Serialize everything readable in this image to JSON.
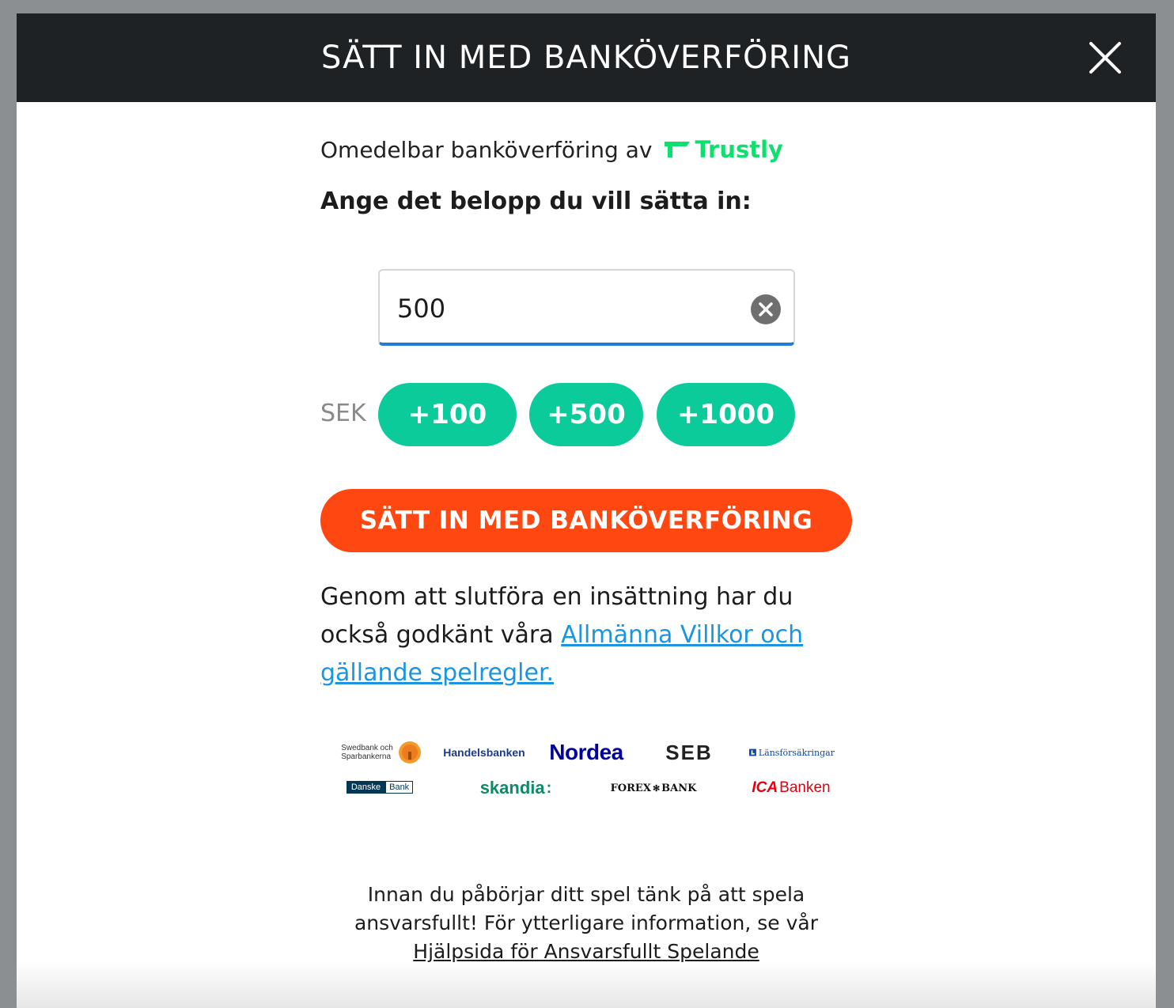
{
  "modal": {
    "title": "SÄTT IN MED BANKÖVERFÖRING"
  },
  "provider": {
    "text": "Omedelbar banköverföring av",
    "brand": "Trustly",
    "brand_color": "#0ee06e"
  },
  "amount": {
    "heading": "Ange det belopp du vill sätta in:",
    "value": "500",
    "currency": "SEK",
    "quick_buttons": [
      "+100",
      "+500",
      "+1000"
    ]
  },
  "deposit_button": "SÄTT IN MED BANKÖVERFÖRING",
  "terms": {
    "text": "Genom att slutföra en insättning har du också godkänt våra ",
    "link": "Allmänna Villkor och gällande spelregler."
  },
  "banks": [
    {
      "name": "Swedbank och Sparbankerna",
      "line1": "Swedbank och",
      "line2": "Sparbankerna"
    },
    {
      "name": "Handelsbanken"
    },
    {
      "name": "Nordea"
    },
    {
      "name": "SEB"
    },
    {
      "name": "Länsförsäkringar"
    },
    {
      "name": "Danske Bank",
      "part1": "Danske",
      "part2": "Bank"
    },
    {
      "name": "skandia"
    },
    {
      "name": "FOREX BANK",
      "part1": "FOREX",
      "part2": "BANK"
    },
    {
      "name": "ICA Banken",
      "part1": "ICA",
      "part2": "Banken"
    }
  ],
  "responsible": {
    "text": "Innan du påbörjar ditt spel tänk på att spela ansvarsfullt! För ytterligare information, se vår",
    "link": "Hjälpsida för Ansvarsfullt Spelande"
  },
  "colors": {
    "header_bg": "#1f2225",
    "quick_button": "#0ccb9a",
    "deposit_button": "#ff4811",
    "link": "#1b95e0",
    "input_underline": "#1f7ad8"
  }
}
